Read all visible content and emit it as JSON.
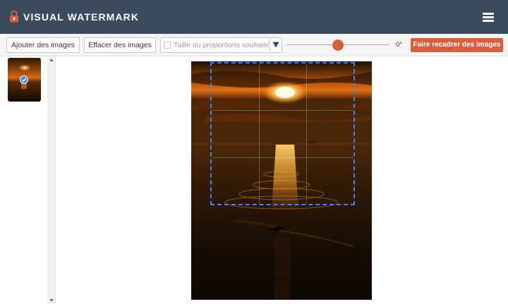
{
  "app": {
    "title": "VISUAL WATERMARK",
    "brand_color": "#3b4a5c",
    "accent_color": "#d75f3e",
    "logo_icon": "lock-icon",
    "menu_icon": "hamburger-menu-icon"
  },
  "toolbar": {
    "add_label": "Ajouter des images",
    "clear_label": "Effacer des images",
    "size_placeholder": "Taille ou proportions souhaitée",
    "size_checked": false,
    "dropdown_icon": "triangle-down-icon",
    "angle_label": "0°",
    "recrop_label": "Faire recadrer des images"
  },
  "sidebar": {
    "thumbnails": [
      {
        "selected": true,
        "check_icon": "checkmark-icon"
      }
    ]
  },
  "editor": {
    "image_description_icon": "sunset-photo",
    "crop_color": "#4d7fe0"
  }
}
